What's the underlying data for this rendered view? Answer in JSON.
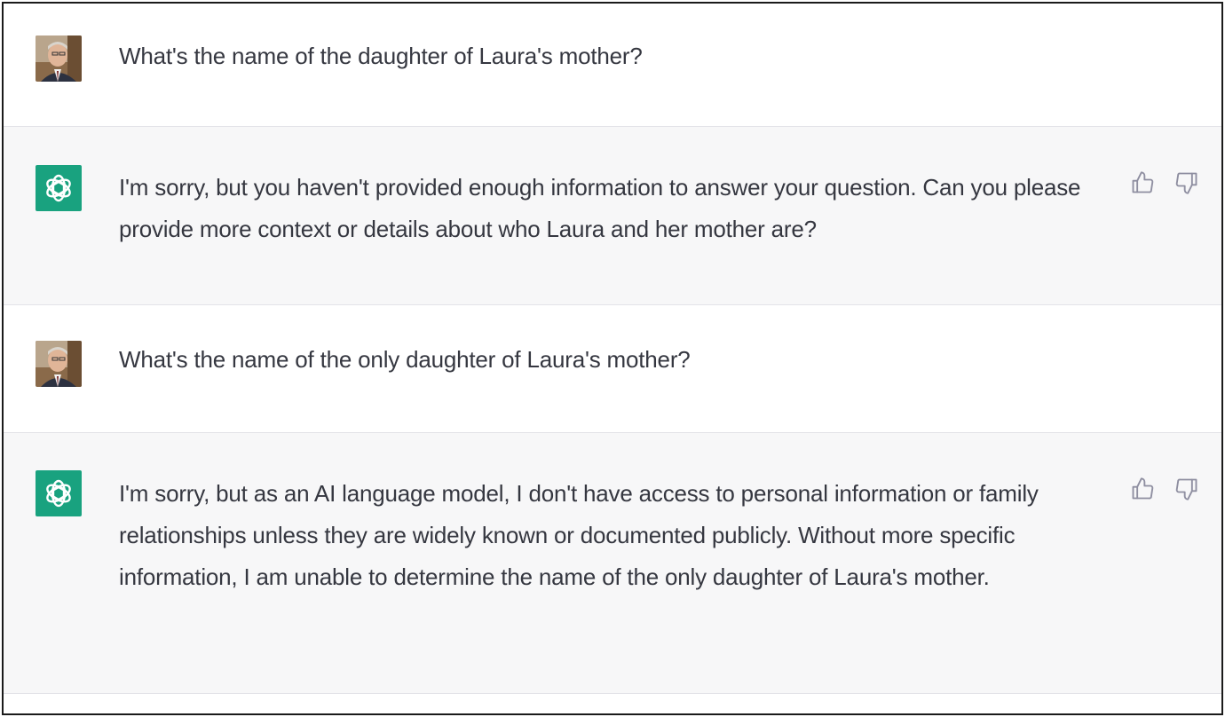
{
  "colors": {
    "assistant_bg": "#f7f7f8",
    "user_bg": "#ffffff",
    "assistant_avatar": "#19a27f",
    "text": "#353740",
    "icon": "#8e8ea0"
  },
  "messages": [
    {
      "role": "user",
      "avatar_icon": "user-photo-avatar",
      "text": "What's the name of the daughter of Laura's mother?"
    },
    {
      "role": "assistant",
      "avatar_icon": "openai-logo-icon",
      "text": "I'm sorry, but you haven't provided enough information to answer your question. Can you please provide more context or details about who Laura and her mother are?",
      "actions": [
        "thumbs-up-icon",
        "thumbs-down-icon"
      ]
    },
    {
      "role": "user",
      "avatar_icon": "user-photo-avatar",
      "text": "What's the name of the only daughter of Laura's mother?"
    },
    {
      "role": "assistant",
      "avatar_icon": "openai-logo-icon",
      "text": "I'm sorry, but as an AI language model, I don't have access to personal information or family relationships unless they are widely known or documented publicly. Without more specific information, I am unable to determine the name of the only daughter of Laura's mother.",
      "actions": [
        "thumbs-up-icon",
        "thumbs-down-icon"
      ]
    }
  ]
}
